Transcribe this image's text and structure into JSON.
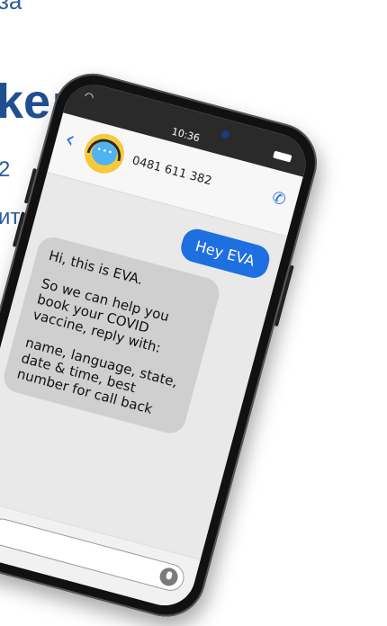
{
  "background": {
    "fragment_top": "за",
    "fragment_heading": "ke:",
    "fragment_number": "2",
    "fragment_text": "ити"
  },
  "phone": {
    "status": {
      "time": "10:36"
    },
    "header": {
      "contact_number": "0481 611 382"
    },
    "messages": {
      "outgoing": "Hey EVA",
      "incoming": {
        "p1": "Hi, this is EVA.",
        "p2": "So we can help you book your COVID vaccine, reply with:",
        "p3": "name, language, state, date & time, best number for call back"
      }
    },
    "colors": {
      "accent": "#1e6fe0",
      "bubble_in": "#cfcfcf"
    }
  }
}
